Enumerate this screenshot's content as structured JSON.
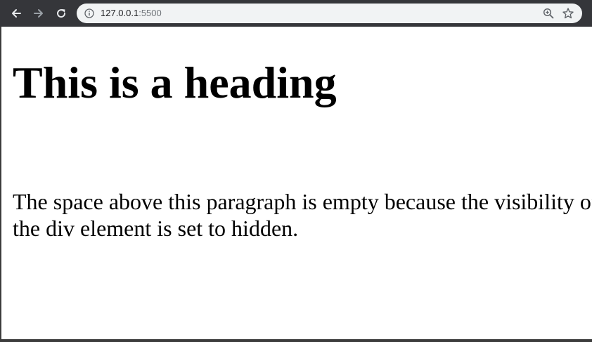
{
  "browser": {
    "url_host": "127.0.0.1",
    "url_port": ":5500",
    "icons": [
      "back-arrow-icon",
      "forward-arrow-icon",
      "reload-icon",
      "info-icon",
      "zoom-icon",
      "star-icon"
    ]
  },
  "page": {
    "heading": "This is a heading",
    "paragraph": "The space above this paragraph is empty because the visibility of the div element is set to hidden."
  }
}
